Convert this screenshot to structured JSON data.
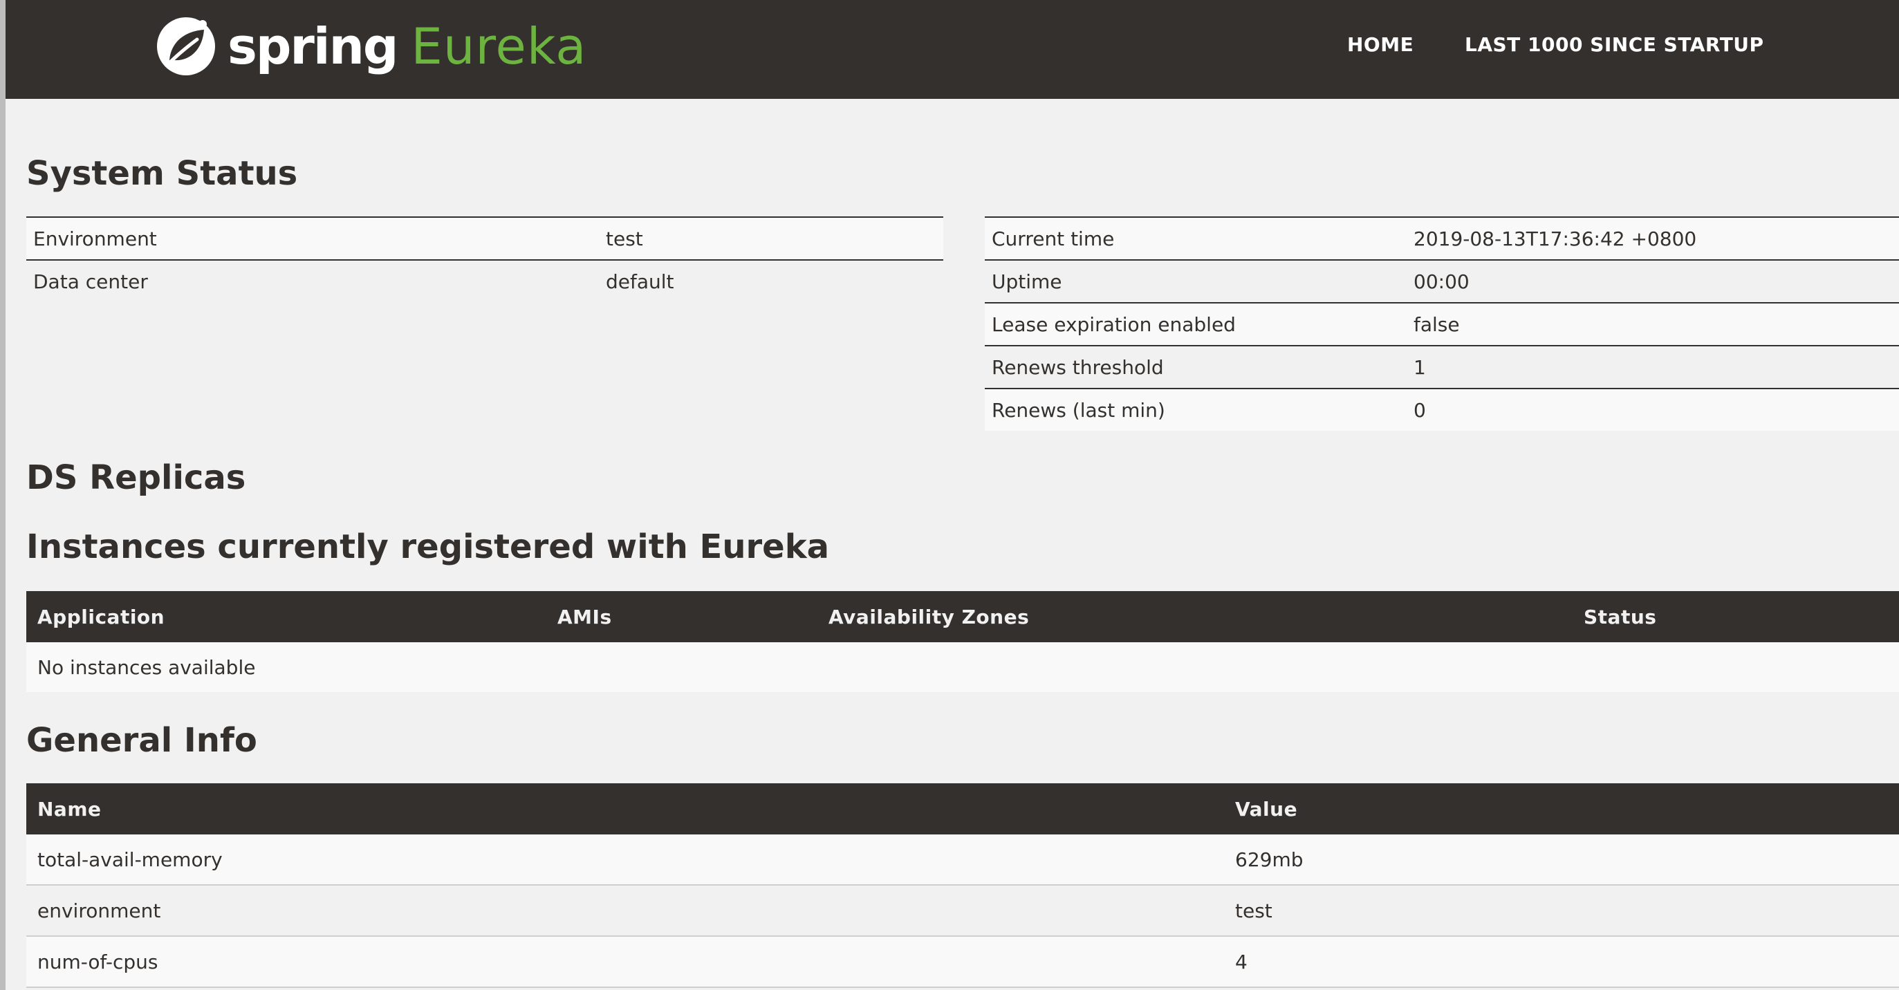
{
  "navbar": {
    "brand_primary": "spring",
    "brand_secondary": "Eureka",
    "logo_icon": "spring-leaf-icon",
    "links": [
      "HOME",
      "LAST 1000 SINCE STARTUP"
    ]
  },
  "system_status": {
    "title": "System Status",
    "left": [
      {
        "key": "Environment",
        "value": "test"
      },
      {
        "key": "Data center",
        "value": "default"
      }
    ],
    "right": [
      {
        "key": "Current time",
        "value": "2019-08-13T17:36:42 +0800"
      },
      {
        "key": "Uptime",
        "value": "00:00"
      },
      {
        "key": "Lease expiration enabled",
        "value": "false"
      },
      {
        "key": "Renews threshold",
        "value": "1"
      },
      {
        "key": "Renews (last min)",
        "value": "0"
      }
    ]
  },
  "ds_replicas": {
    "title": "DS Replicas"
  },
  "instances": {
    "title": "Instances currently registered with Eureka",
    "columns": [
      "Application",
      "AMIs",
      "Availability Zones",
      "Status"
    ],
    "empty_message": "No instances available"
  },
  "general_info": {
    "title": "General Info",
    "columns": [
      "Name",
      "Value"
    ],
    "rows": [
      {
        "name": "total-avail-memory",
        "value": "629mb"
      },
      {
        "name": "environment",
        "value": "test"
      },
      {
        "name": "num-of-cpus",
        "value": "4"
      }
    ]
  },
  "colors": {
    "header_bg": "#34302d",
    "accent_green": "#6db33f",
    "page_bg": "#f1f1f1"
  }
}
